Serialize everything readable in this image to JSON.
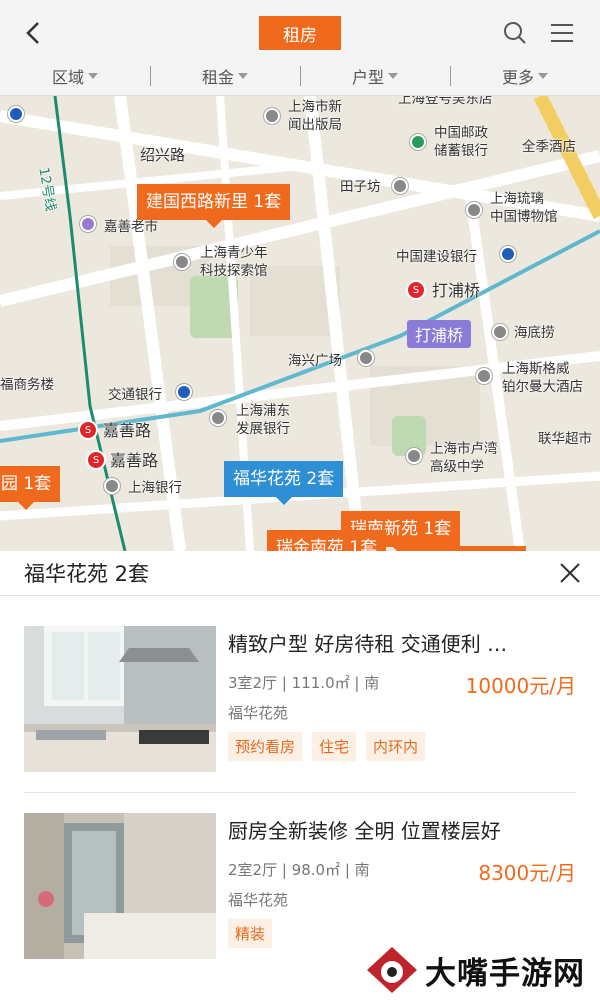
{
  "header": {
    "title": "租房",
    "filters": [
      "区域",
      "租金",
      "户型",
      "更多"
    ]
  },
  "map": {
    "labels": {
      "press": "上海市新\n闻出版局",
      "bank_china": "上海登号吴东店",
      "post": "中国邮政\n储蓄银行",
      "hotel": "全季酒店",
      "shaoxing": "绍兴路",
      "tianzifang": "田子坊",
      "museum": "上海琉璃\n中国博物馆",
      "jiashan_market": "嘉善老市",
      "youth": "上海青少年\n科技探索馆",
      "ccb": "中国建设银行",
      "dapuqiao": "打浦桥",
      "haidilao": "海底捞",
      "haixing": "海兴广场",
      "fuzhou": "福商务楼",
      "jiaotong": "交通银行",
      "sports": "上海斯格威\n铂尔曼大酒店",
      "pudong_bank": "上海浦东\n发展银行",
      "luwan": "上海市卢湾\n高级中学",
      "lianhua": "联华超市",
      "jiashanlu1": "嘉善路",
      "jiashanlu2": "嘉善路",
      "shbank": "上海银行",
      "line": "12号线"
    },
    "markers": {
      "m1": "建国西路新里 1套",
      "m2": "福华花苑 2套",
      "m3": "瑞南新苑 1套",
      "m4": "瑞金南苑 1套",
      "m5": "园 1套",
      "station": "打浦桥"
    }
  },
  "sheet": {
    "title": "福华花苑  2套",
    "listings": [
      {
        "title": "精致户型 好房待租 交通便利 …",
        "details": "3室2厅 | 111.0㎡ | 南",
        "community": "福华花苑",
        "price": "10000元/月",
        "tags": [
          "预约看房",
          "住宅",
          "内环内"
        ]
      },
      {
        "title": "厨房全新装修 全明 位置楼层好",
        "details": "2室2厅 | 98.0㎡ | 南",
        "community": "福华花苑",
        "price": "8300元/月",
        "tags": [
          "精装"
        ]
      }
    ]
  },
  "watermark": {
    "text": "大嘴手游网"
  },
  "colors": {
    "accent": "#f06a1e",
    "blue_marker": "#2f8fd5"
  }
}
